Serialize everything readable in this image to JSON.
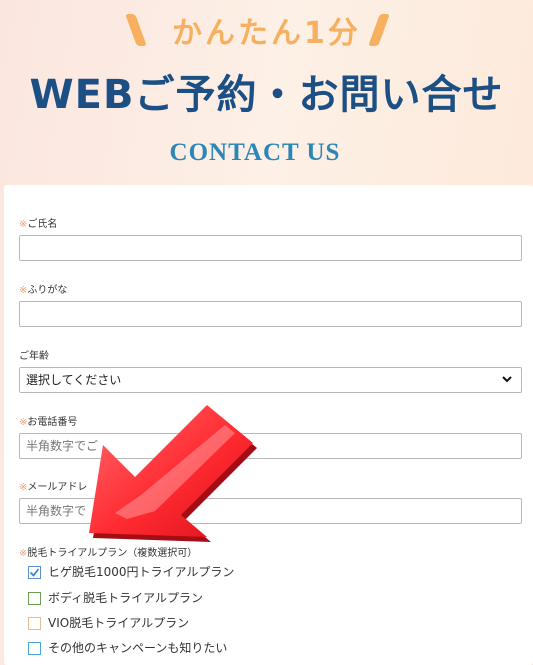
{
  "hero": {
    "tagline": "かんたん1分",
    "title": "WEBご予約・お問い合せ",
    "subtitle": "CONTACT US"
  },
  "form": {
    "required_mark": "※",
    "name": {
      "label": "ご氏名",
      "value": ""
    },
    "furigana": {
      "label": "ふりがな",
      "value": ""
    },
    "age": {
      "label": "ご年齢",
      "selected": "選択してください"
    },
    "phone": {
      "label": "お電話番号",
      "placeholder": "半角数字でご"
    },
    "email": {
      "label": "メールアドレ",
      "placeholder": "半角数字で"
    },
    "plan": {
      "label": "脱毛トライアルプラン（複数選択可）",
      "options": [
        {
          "label": "ヒゲ脱毛1000円トライアルプラン",
          "checked": true,
          "border_color": "#5b8fd0"
        },
        {
          "label": "ボディ脱毛トライアルプラン",
          "checked": false,
          "border_color": "#6aa056"
        },
        {
          "label": "VIO脱毛トライアルプラン",
          "checked": false,
          "border_color": "#f0b98a"
        },
        {
          "label": "その他のキャンペーンも知りたい",
          "checked": false,
          "border_color": "#4aa6d8"
        }
      ]
    }
  },
  "colors": {
    "tagline": "#f6b05f",
    "title": "#1c4f84",
    "subtitle": "#2d86b8",
    "required": "#f0a07a",
    "arrow": "#e8232b"
  },
  "overlay": {
    "icon": "red-arrow-icon"
  }
}
